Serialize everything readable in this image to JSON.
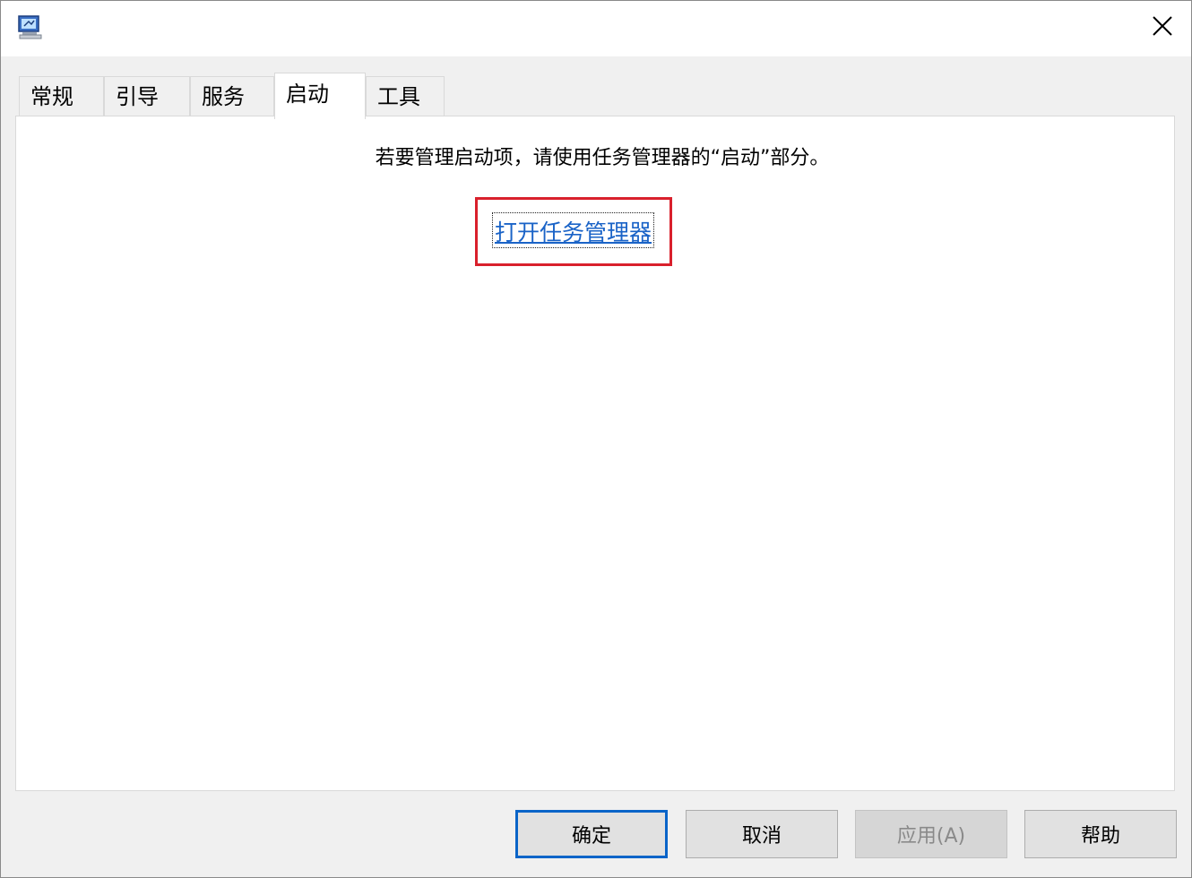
{
  "window": {
    "icon": "msconfig-computer-icon",
    "close_icon": "close-icon"
  },
  "tabs": [
    {
      "label": "常规",
      "active": false
    },
    {
      "label": "引导",
      "active": false
    },
    {
      "label": "服务",
      "active": false
    },
    {
      "label": "启动",
      "active": true
    },
    {
      "label": "工具",
      "active": false
    }
  ],
  "startup_panel": {
    "message": "若要管理启动项，请使用任务管理器的“启动”部分。",
    "link_label": "打开任务管理器",
    "highlight_color": "#d9202c"
  },
  "buttons": {
    "ok": "确定",
    "cancel": "取消",
    "apply": "应用(A)",
    "help": "帮助"
  },
  "colors": {
    "link": "#1a63c7",
    "default_button_border": "#0a64c8"
  }
}
